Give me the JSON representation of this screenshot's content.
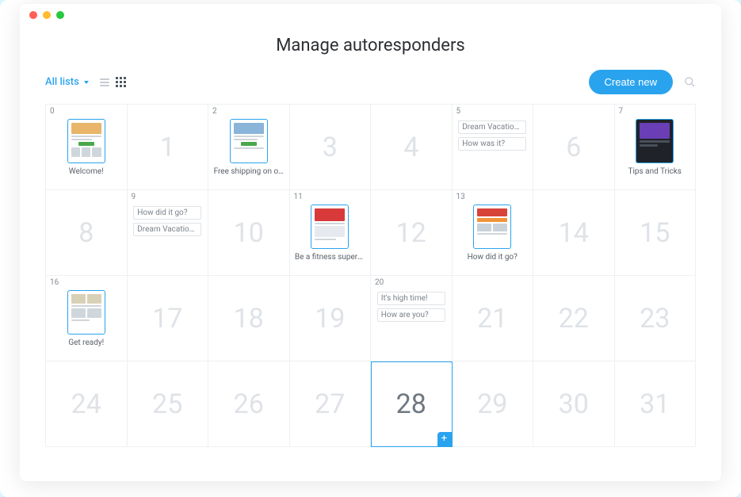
{
  "title": "Manage autoresponders",
  "toolbar": {
    "filter_label": "All lists",
    "create_label": "Create new"
  },
  "cells": {
    "c0": {
      "index": "0",
      "caption": "Welcome!"
    },
    "c1": {
      "big": "1"
    },
    "c2": {
      "index": "2",
      "caption": "Free shipping on o…"
    },
    "c3": {
      "big": "3"
    },
    "c4": {
      "big": "4"
    },
    "c5": {
      "index": "5",
      "pill1": "Dream Vacatio…",
      "pill2": "How was it?"
    },
    "c6": {
      "big": "6"
    },
    "c7": {
      "index": "7",
      "caption": "Tips and Tricks"
    },
    "c8": {
      "big": "8"
    },
    "c9": {
      "index": "9",
      "pill1": "How did it go?",
      "pill2": "Dream Vacatio…"
    },
    "c10": {
      "big": "10"
    },
    "c11": {
      "index": "11",
      "caption": "Be a fitness supers…"
    },
    "c12": {
      "big": "12"
    },
    "c13": {
      "index": "13",
      "caption": "How did it go?"
    },
    "c14": {
      "big": "14"
    },
    "c15": {
      "big": "15"
    },
    "c16": {
      "index": "16",
      "caption": "Get ready!"
    },
    "c17": {
      "big": "17"
    },
    "c18": {
      "big": "18"
    },
    "c19": {
      "big": "19"
    },
    "c20": {
      "index": "20",
      "pill1": "It's high time!",
      "pill2": "How are you?"
    },
    "c21": {
      "big": "21"
    },
    "c22": {
      "big": "22"
    },
    "c23": {
      "big": "23"
    },
    "c24": {
      "big": "24"
    },
    "c25": {
      "big": "25"
    },
    "c26": {
      "big": "26"
    },
    "c27": {
      "big": "27"
    },
    "c28": {
      "big": "28"
    },
    "c29": {
      "big": "29"
    },
    "c30": {
      "big": "30"
    },
    "c31": {
      "big": "31"
    }
  },
  "add_label": "+"
}
